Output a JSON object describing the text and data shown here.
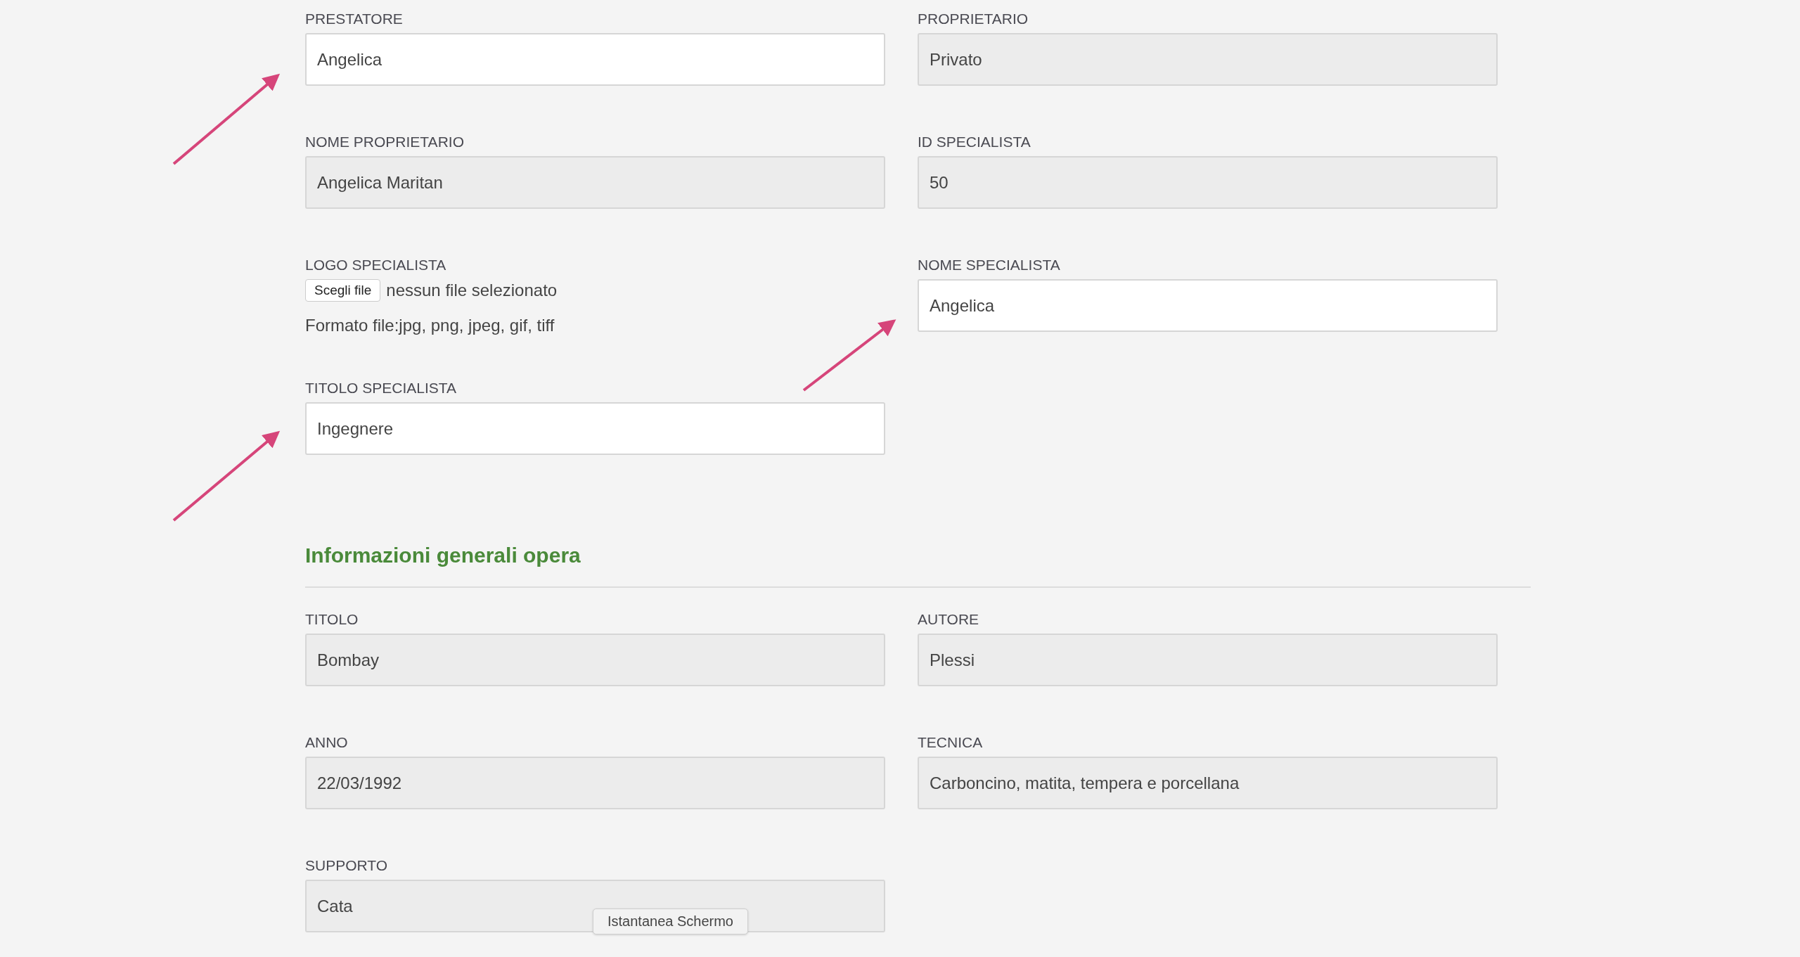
{
  "sections": [
    {
      "fields": [
        {
          "kind": "text",
          "label": "PRESTATORE",
          "value": "Angelica",
          "readonly": false
        },
        {
          "kind": "text",
          "label": "PROPRIETARIO",
          "value": "Privato",
          "readonly": true
        },
        {
          "kind": "text",
          "label": "NOME PROPRIETARIO",
          "value": "Angelica Maritan",
          "readonly": true
        },
        {
          "kind": "text",
          "label": "ID SPECIALISTA",
          "value": "50",
          "readonly": true
        },
        {
          "kind": "file",
          "label": "LOGO SPECIALISTA",
          "button": "Scegli file",
          "status": "nessun file selezionato",
          "hint": "Formato file:jpg, png, jpeg, gif, tiff"
        },
        {
          "kind": "text",
          "label": "NOME SPECIALISTA",
          "value": "Angelica",
          "readonly": false
        },
        {
          "kind": "text",
          "label": "TITOLO SPECIALISTA",
          "value": "Ingegnere",
          "readonly": false
        }
      ]
    },
    {
      "heading": "Informazioni generali opera",
      "fields": [
        {
          "kind": "text",
          "label": "TITOLO",
          "value": "Bombay",
          "readonly": true
        },
        {
          "kind": "text",
          "label": "AUTORE",
          "value": "Plessi",
          "readonly": true
        },
        {
          "kind": "text",
          "label": "ANNO",
          "value": "22/03/1992",
          "readonly": true
        },
        {
          "kind": "text",
          "label": "TECNICA",
          "value": "Carboncino, matita, tempera e porcellana",
          "readonly": true
        },
        {
          "kind": "text",
          "label": "SUPPORTO",
          "value": "Cata",
          "readonly": true
        }
      ]
    }
  ],
  "tooltip": {
    "text": "Istantanea Schermo"
  }
}
